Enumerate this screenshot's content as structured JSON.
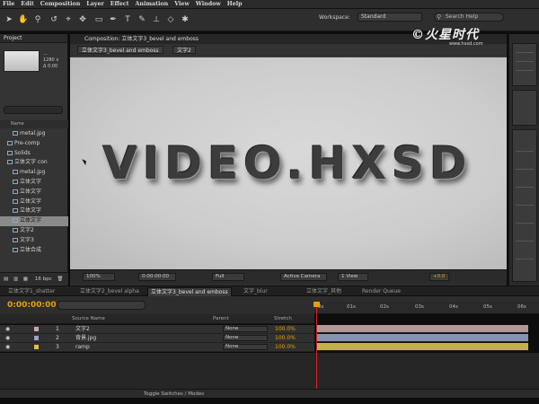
{
  "menu": [
    "File",
    "Edit",
    "Composition",
    "Layer",
    "Effect",
    "Animation",
    "View",
    "Window",
    "Help"
  ],
  "toolbar": {
    "workspace_label": "Workspace:",
    "workspace_value": "Standard",
    "search_placeholder": "Search Help",
    "tools": [
      "selection-tool-icon",
      "hand-tool-icon",
      "zoom-tool-icon",
      "rotate-tool-icon",
      "camera-tool-icon",
      "pan-behind-tool-icon",
      "mask-tool-icon",
      "pen-tool-icon",
      "type-tool-icon",
      "brush-tool-icon",
      "clone-tool-icon",
      "eraser-tool-icon",
      "puppet-tool-icon"
    ]
  },
  "logo": {
    "text": "©火星时代",
    "url": "www.hxsd.com"
  },
  "project": {
    "tab": "Project",
    "thumb_name": "...",
    "thumb_size": "1280 x",
    "thumb_dur": "Δ 0:00",
    "name_header": "Name",
    "items": [
      {
        "name": "metal.jpg",
        "sel": false
      },
      {
        "name": "Pre-comp",
        "sel": false
      },
      {
        "name": "Solids",
        "sel": false
      },
      {
        "name": "立体文字 con",
        "sel": false
      },
      {
        "name": "metal.jpg",
        "sel": false
      },
      {
        "name": "立体文字",
        "sel": false
      },
      {
        "name": "立体文字",
        "sel": false
      },
      {
        "name": "立体文字",
        "sel": false
      },
      {
        "name": "立体文字",
        "sel": false
      },
      {
        "name": "立体文字",
        "sel": true
      },
      {
        "name": "文字2",
        "sel": false
      },
      {
        "name": "文字3",
        "sel": false
      },
      {
        "name": "立体合成",
        "sel": false
      }
    ],
    "bpc": "16 bpc"
  },
  "composition": {
    "tab": "Composition: 立体文字3_bevel and emboss",
    "sub_tabs": [
      "立体文字3_bevel and emboss",
      "文字2"
    ],
    "headline": "VIDEO.HXSD",
    "zoom": "100%",
    "time": "0:00:00:00",
    "resolution": "Full",
    "camera": "Active Camera",
    "views": "1 View",
    "exposure": "+0.0"
  },
  "timeline": {
    "tabs": [
      {
        "label": "立体文字1_shatter",
        "active": false
      },
      {
        "label": "立体文字2_bevel alpha",
        "active": false
      },
      {
        "label": "立体文字3_bevel and emboss",
        "active": true
      },
      {
        "label": "文字_blur",
        "active": false
      },
      {
        "label": "立体文字_其他",
        "active": false
      },
      {
        "label": "Render Queue",
        "active": false
      }
    ],
    "timecode": "0:00:00:00",
    "columns": {
      "source_name": "Source Name",
      "parent": "Parent",
      "stretch": "Stretch"
    },
    "layers": [
      {
        "num": "1",
        "name": "文字2",
        "color": "#c9a7a7",
        "parent": "None",
        "stretch": "100.0%"
      },
      {
        "num": "2",
        "name": "背景.jpg",
        "color": "#9aa3c8",
        "parent": "None",
        "stretch": "100.0%"
      },
      {
        "num": "3",
        "name": "ramp",
        "color": "#d8c44a",
        "parent": "None",
        "stretch": "100.0%"
      }
    ],
    "ruler_ticks": [
      "0s",
      "01s",
      "02s",
      "03s",
      "04s",
      "05s",
      "06s"
    ],
    "footer": "Toggle Switches / Modes"
  }
}
